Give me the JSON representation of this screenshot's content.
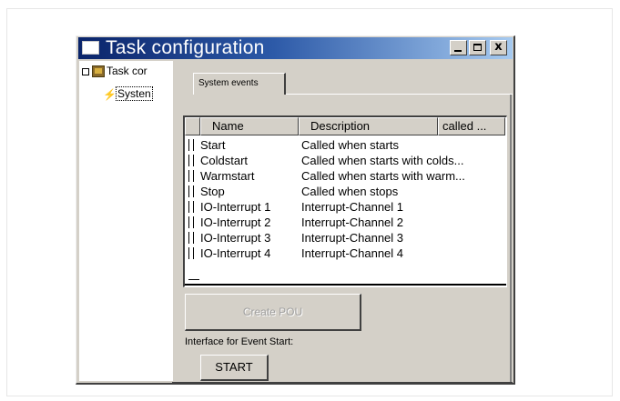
{
  "window": {
    "title": "Task configuration",
    "buttons": {
      "minimize": "_",
      "maximize": "□",
      "close": "x"
    }
  },
  "tree": {
    "root_label": "Task cor",
    "child_label": "Systen",
    "icons": {
      "root": "folder-icon",
      "child": "bolt-icon"
    }
  },
  "tab": {
    "label": "System events"
  },
  "listview": {
    "columns": [
      "Name",
      "Description",
      "called ..."
    ],
    "rows": [
      {
        "name": "Start",
        "description": "Called when starts"
      },
      {
        "name": "Coldstart",
        "description": "Called when starts with colds..."
      },
      {
        "name": "Warmstart",
        "description": "Called when starts with warm..."
      },
      {
        "name": "Stop",
        "description": "Called when stops"
      },
      {
        "name": "IO-Interrupt 1",
        "description": "Interrupt-Channel 1"
      },
      {
        "name": "IO-Interrupt 2",
        "description": "Interrupt-Channel 2"
      },
      {
        "name": "IO-Interrupt 3",
        "description": "Interrupt-Channel 3"
      },
      {
        "name": "IO-Interrupt 4",
        "description": "Interrupt-Channel 4"
      }
    ]
  },
  "create_button": {
    "label": "Create POU"
  },
  "interface": {
    "label": "Interface for Event Start:",
    "button": "START"
  },
  "colors": {
    "titlebar_start": "#0a246a",
    "titlebar_end": "#a6caf0",
    "face": "#d4d0c8"
  }
}
